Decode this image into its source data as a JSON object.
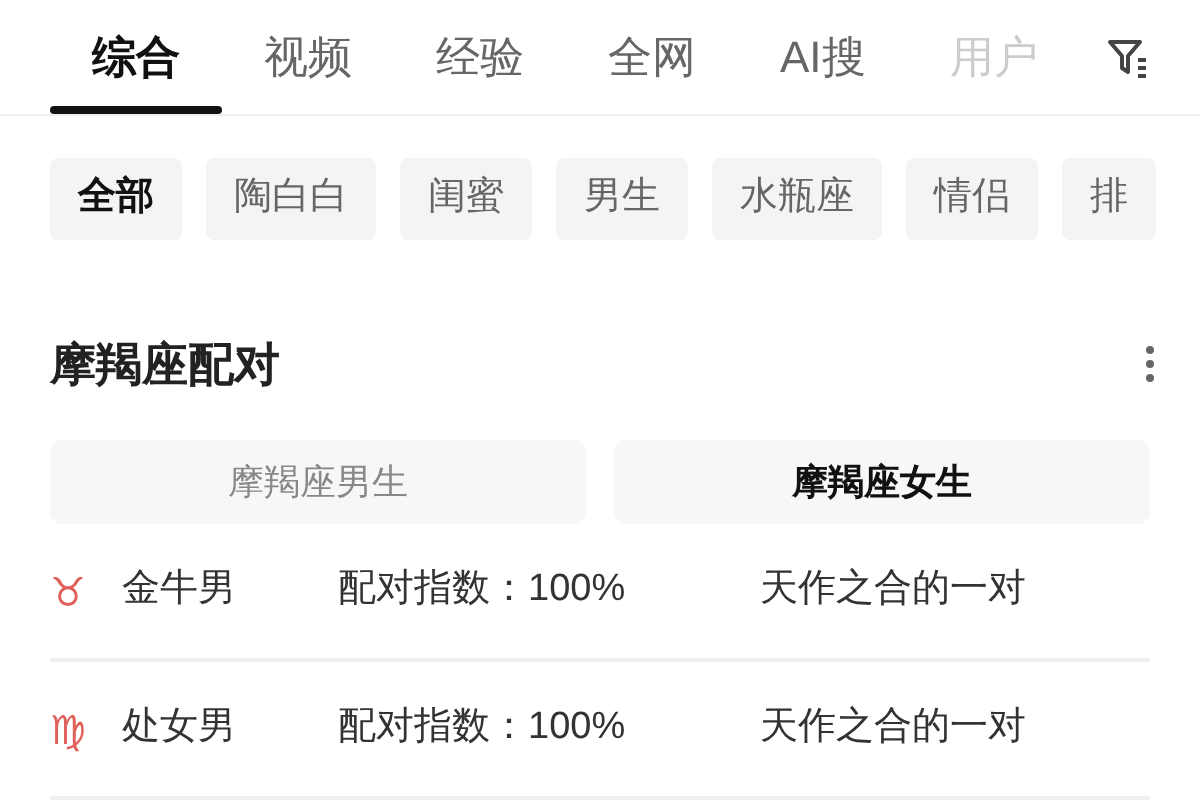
{
  "tabs": [
    {
      "label": "综合",
      "selected": true
    },
    {
      "label": "视频",
      "selected": false
    },
    {
      "label": "经验",
      "selected": false
    },
    {
      "label": "全网",
      "selected": false
    },
    {
      "label": "AI搜",
      "selected": false
    },
    {
      "label": "用户",
      "selected": false,
      "faded": true
    }
  ],
  "chips": [
    {
      "label": "全部",
      "selected": true
    },
    {
      "label": "陶白白",
      "selected": false
    },
    {
      "label": "闺蜜",
      "selected": false
    },
    {
      "label": "男生",
      "selected": false
    },
    {
      "label": "水瓶座",
      "selected": false
    },
    {
      "label": "情侣",
      "selected": false
    },
    {
      "label": "排",
      "selected": false
    }
  ],
  "card": {
    "title": "摩羯座配对",
    "segments": [
      {
        "label": "摩羯座男生",
        "selected": false
      },
      {
        "label": "摩羯座女生",
        "selected": true
      }
    ],
    "rows": [
      {
        "symbol": "♉",
        "sign": "金牛男",
        "score": "配对指数：100%",
        "verdict": "天作之合的一对"
      },
      {
        "symbol": "♍",
        "sign": "处女男",
        "score": "配对指数：100%",
        "verdict": "天作之合的一对"
      }
    ]
  }
}
